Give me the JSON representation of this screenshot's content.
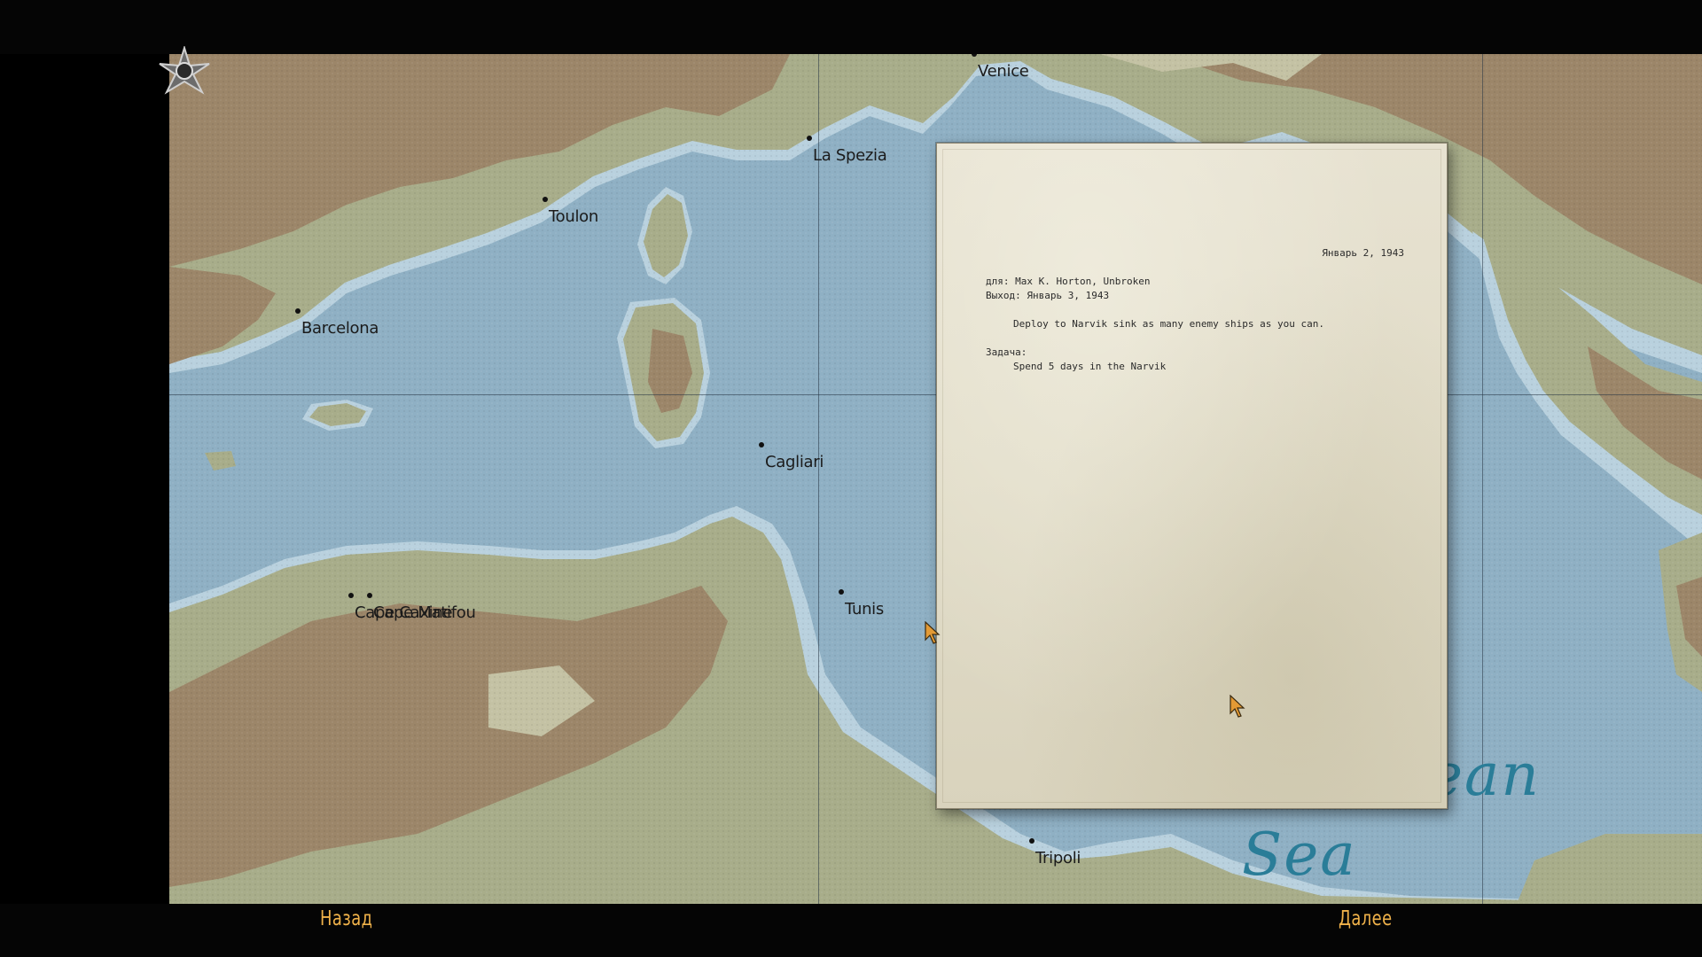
{
  "map": {
    "cities": [
      {
        "name": "Venice"
      },
      {
        "name": "La Spezia"
      },
      {
        "name": "Toulon"
      },
      {
        "name": "Barcelona"
      },
      {
        "name": "Cagliari"
      },
      {
        "name": "Tunis"
      },
      {
        "name": "Cape Caxine"
      },
      {
        "name": "Cape Matifou"
      },
      {
        "name": "Tripoli"
      }
    ],
    "sea_label_line1": "ean",
    "sea_label_line2": "Sea",
    "colors": {
      "sea": "#8fb0c4",
      "shallow": "#b9d1de",
      "lowland": "#a8ad8a",
      "highland": "#9c8669",
      "city_dot": "#111111"
    }
  },
  "orders": {
    "date": "Январь 2, 1943",
    "to_label": "для:",
    "to_value": "Max K. Horton, Unbroken",
    "departure_label": "Выход:",
    "departure_value": "Январь 3, 1943",
    "orders_text": "Deploy to Narvik sink as many enemy ships as you can.",
    "task_label": "Задача:",
    "task_text": "Spend 5 days in the Narvik"
  },
  "nav": {
    "back_label": "Назад",
    "next_label": "Далее",
    "accent_color": "#f0b24a"
  },
  "icons": [
    "compass-star-icon",
    "arrow-cursor-icon"
  ]
}
